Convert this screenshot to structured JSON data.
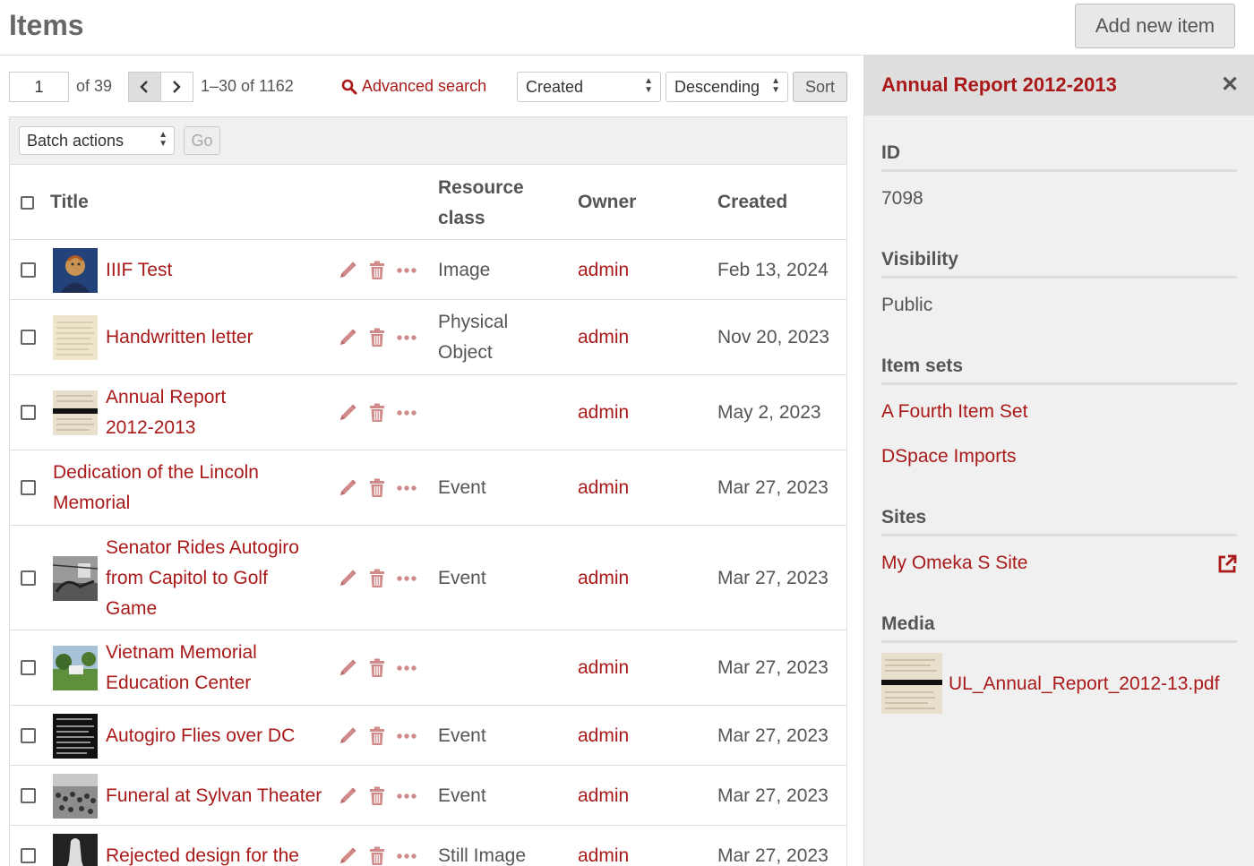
{
  "header": {
    "title": "Items",
    "add_button": "Add new item"
  },
  "pagination": {
    "page": "1",
    "of_label": "of 39",
    "range": "1–30 of 1162"
  },
  "advanced_search": "Advanced search",
  "sort": {
    "field": "Created",
    "order": "Descending",
    "button": "Sort"
  },
  "batch": {
    "select": "Batch actions",
    "go": "Go"
  },
  "columns": {
    "title": "Title",
    "resource_class_1": "Resource",
    "resource_class_2": "class",
    "owner": "Owner",
    "created": "Created"
  },
  "rows": [
    {
      "title": [
        "IIIF Test"
      ],
      "resource_class": [
        "Image"
      ],
      "owner": "admin",
      "created": "Feb 13, 2024",
      "thumb": "portrait"
    },
    {
      "title": [
        "Handwritten letter"
      ],
      "resource_class": [
        "Physical",
        "Object"
      ],
      "owner": "admin",
      "created": "Nov 20, 2023",
      "thumb": "letter"
    },
    {
      "title": [
        "Annual Report",
        "2012-2013"
      ],
      "resource_class": [],
      "owner": "admin",
      "created": "May 2, 2023",
      "thumb": "report"
    },
    {
      "title": [
        "Dedication of the Lincoln",
        "Memorial"
      ],
      "resource_class": [
        "Event"
      ],
      "owner": "admin",
      "created": "Mar 27, 2023",
      "thumb": ""
    },
    {
      "title": [
        "Senator Rides Autogiro",
        "from Capitol to Golf",
        "Game"
      ],
      "resource_class": [
        "Event"
      ],
      "owner": "admin",
      "created": "Mar 27, 2023",
      "thumb": "photo-bw"
    },
    {
      "title": [
        "Vietnam Memorial",
        "Education Center"
      ],
      "resource_class": [],
      "owner": "admin",
      "created": "Mar 27, 2023",
      "thumb": "photo-color"
    },
    {
      "title": [
        "Autogiro Flies over DC"
      ],
      "resource_class": [
        "Event"
      ],
      "owner": "admin",
      "created": "Mar 27, 2023",
      "thumb": "newspaper"
    },
    {
      "title": [
        "Funeral at Sylvan Theater"
      ],
      "resource_class": [
        "Event"
      ],
      "owner": "admin",
      "created": "Mar 27, 2023",
      "thumb": "crowd"
    },
    {
      "title": [
        "Rejected design for the"
      ],
      "resource_class": [
        "Still Image"
      ],
      "owner": "admin",
      "created": "Mar 27, 2023",
      "thumb": "statue"
    }
  ],
  "sidebar": {
    "title": "Annual Report 2012-2013",
    "id_label": "ID",
    "id_value": "7098",
    "visibility_label": "Visibility",
    "visibility_value": "Public",
    "item_sets_label": "Item sets",
    "item_sets": [
      "A Fourth Item Set",
      "DSpace Imports"
    ],
    "sites_label": "Sites",
    "site": "My Omeka S Site",
    "media_label": "Media",
    "media_file": "UL_Annual_Report_2012-13.pdf"
  },
  "colors": {
    "link": "#a91919",
    "text": "#555555",
    "sidebar_bg": "#f0f0f0"
  }
}
